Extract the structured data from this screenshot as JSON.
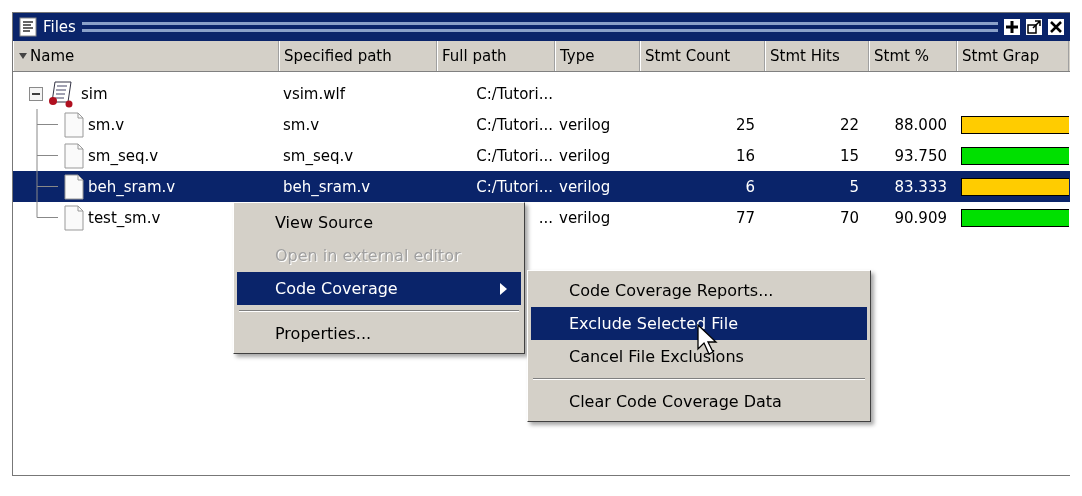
{
  "panel": {
    "title": "Files"
  },
  "columns": [
    "Name",
    "Specified path",
    "Full path",
    "Type",
    "Stmt Count",
    "Stmt Hits",
    "Stmt %",
    "Stmt Grap"
  ],
  "tree": {
    "name": "sim",
    "specified_path": "vsim.wlf",
    "full_path": "C:/Tutori...",
    "expanded": true,
    "selected": false,
    "children": [
      {
        "name": "sm.v",
        "specified_path": "sm.v",
        "full_path": "C:/Tutori...",
        "type": "verilog",
        "count": "25",
        "hits": "22",
        "percent": "88.000",
        "color": "#ffcc00",
        "selected": false
      },
      {
        "name": "sm_seq.v",
        "specified_path": "sm_seq.v",
        "full_path": "C:/Tutori...",
        "type": "verilog",
        "count": "16",
        "hits": "15",
        "percent": "93.750",
        "color": "#00e000",
        "selected": false
      },
      {
        "name": "beh_sram.v",
        "specified_path": "beh_sram.v",
        "full_path": "C:/Tutori...",
        "type": "verilog",
        "count": "6",
        "hits": "5",
        "percent": "83.333",
        "color": "#ffcc00",
        "selected": true
      },
      {
        "name": "test_sm.v",
        "full_path": "...",
        "type": "verilog",
        "count": "77",
        "hits": "70",
        "percent": "90.909",
        "color": "#00e000",
        "selected": false
      }
    ]
  },
  "context_menu": [
    {
      "kind": "item",
      "label": "View Source",
      "disabled": false,
      "selected": false
    },
    {
      "kind": "item",
      "label": "Open in external editor",
      "disabled": true,
      "selected": false
    },
    {
      "kind": "submenu",
      "label": "Code Coverage",
      "disabled": false,
      "selected": true
    },
    {
      "kind": "separator"
    },
    {
      "kind": "item",
      "label": "Properties...",
      "disabled": false,
      "selected": false
    }
  ],
  "submenu": [
    {
      "kind": "item",
      "label": "Code Coverage Reports...",
      "disabled": false,
      "selected": false
    },
    {
      "kind": "item",
      "label": "Exclude Selected File",
      "disabled": false,
      "selected": true
    },
    {
      "kind": "item",
      "label": "Cancel File Exclusions",
      "disabled": false,
      "selected": false
    },
    {
      "kind": "separator"
    },
    {
      "kind": "item",
      "label": "Clear Code Coverage Data",
      "disabled": false,
      "selected": false
    }
  ]
}
